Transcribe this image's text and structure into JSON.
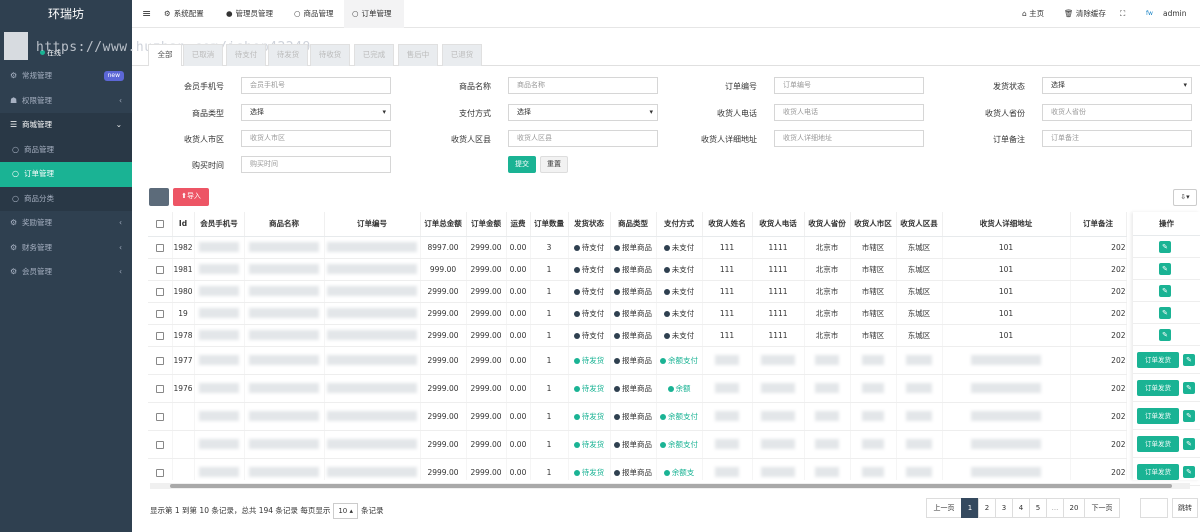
{
  "app": {
    "title": "环瑞坊",
    "status_label": "在线",
    "watermark": "https://www.huzhan.com/ishop42249"
  },
  "sidebar": {
    "items": [
      {
        "label": "常规管理",
        "icon": "cogs-icon",
        "badge": "new"
      },
      {
        "label": "权限管理",
        "icon": "group-icon",
        "arrow": "‹"
      },
      {
        "label": "商城管理",
        "icon": "list-icon",
        "arrow": "⌄"
      },
      {
        "label": "商品管理",
        "icon": "circle-icon"
      },
      {
        "label": "订单管理",
        "icon": "circle-icon"
      },
      {
        "label": "商品分类",
        "icon": "circle-icon"
      },
      {
        "label": "奖励管理",
        "icon": "gear-icon",
        "arrow": "‹"
      },
      {
        "label": "财务管理",
        "icon": "gear-icon",
        "arrow": "‹"
      },
      {
        "label": "会员管理",
        "icon": "gear-icon",
        "arrow": "‹"
      }
    ]
  },
  "topbar": {
    "tabs": [
      {
        "label": "系统配置",
        "icon": "cog-icon"
      },
      {
        "label": "管理员管理",
        "icon": "user-icon"
      },
      {
        "label": "商品管理",
        "icon": "circle-icon"
      },
      {
        "label": "订单管理",
        "icon": "circle-icon"
      }
    ],
    "home": "主页",
    "clear_cache": "清除缓存",
    "user": "admin",
    "avatar_text": "fw"
  },
  "status_tabs": [
    "全部",
    "已取消",
    "待支付",
    "待发货",
    "待收货",
    "已完成",
    "售后中",
    "已退货"
  ],
  "filters": {
    "member_phone": {
      "label": "会员手机号",
      "placeholder": "会员手机号"
    },
    "goods_name": {
      "label": "商品名称",
      "placeholder": "商品名称"
    },
    "order_no": {
      "label": "订单编号",
      "placeholder": "订单编号"
    },
    "ship_status": {
      "label": "发货状态",
      "value": "选择"
    },
    "goods_type": {
      "label": "商品类型",
      "value": "选择"
    },
    "pay_method": {
      "label": "支付方式",
      "value": "选择"
    },
    "receiver_phone": {
      "label": "收货人电话",
      "placeholder": "收货人电话"
    },
    "receiver_province": {
      "label": "收货人省份",
      "placeholder": "收货人省份"
    },
    "receiver_city": {
      "label": "收货人市区",
      "placeholder": "收货人市区"
    },
    "receiver_district": {
      "label": "收货人区县",
      "placeholder": "收货人区县"
    },
    "receiver_address": {
      "label": "收货人详细地址",
      "placeholder": "收货人详细地址"
    },
    "order_remark": {
      "label": "订单备注",
      "placeholder": "订单备注"
    },
    "buy_time": {
      "label": "购买时间",
      "placeholder": "购买时间"
    },
    "submit": "提交",
    "reset": "重置"
  },
  "toolbar": {
    "import": "导入"
  },
  "table": {
    "headers": [
      "Id",
      "会员手机号",
      "商品名称",
      "订单编号",
      "订单总金额",
      "订单金额",
      "运费",
      "订单数量",
      "发货状态",
      "商品类型",
      "支付方式",
      "收货人姓名",
      "收货人电话",
      "收货人省份",
      "收货人市区",
      "收货人区县",
      "收货人详细地址",
      "订单备注"
    ],
    "op_header": "操作",
    "rows": [
      {
        "id": "1982",
        "total": "8997.00",
        "amount": "2999.00",
        "freight": "0.00",
        "qty": "3",
        "ship": "待支付",
        "type": "报单商品",
        "pay": "未支付",
        "name": "111",
        "phone": "1111",
        "prov": "北京市",
        "city": "市辖区",
        "dist": "东城区",
        "addr": "101",
        "remark": "202",
        "action": "edit"
      },
      {
        "id": "1981",
        "total": "999.00",
        "amount": "2999.00",
        "freight": "0.00",
        "qty": "1",
        "ship": "待支付",
        "type": "报单商品",
        "pay": "未支付",
        "name": "111",
        "phone": "1111",
        "prov": "北京市",
        "city": "市辖区",
        "dist": "东城区",
        "addr": "101",
        "remark": "202",
        "action": "edit"
      },
      {
        "id": "1980",
        "total": "2999.00",
        "amount": "2999.00",
        "freight": "0.00",
        "qty": "1",
        "ship": "待支付",
        "type": "报单商品",
        "pay": "未支付",
        "name": "111",
        "phone": "1111",
        "prov": "北京市",
        "city": "市辖区",
        "dist": "东城区",
        "addr": "101",
        "remark": "202",
        "action": "edit"
      },
      {
        "id": "19",
        "total": "2999.00",
        "amount": "2999.00",
        "freight": "0.00",
        "qty": "1",
        "ship": "待支付",
        "type": "报单商品",
        "pay": "未支付",
        "name": "111",
        "phone": "1111",
        "prov": "北京市",
        "city": "市辖区",
        "dist": "东城区",
        "addr": "101",
        "remark": "202",
        "action": "edit"
      },
      {
        "id": "1978",
        "total": "2999.00",
        "amount": "2999.00",
        "freight": "0.00",
        "qty": "1",
        "ship": "待支付",
        "type": "报单商品",
        "pay": "未支付",
        "name": "111",
        "phone": "1111",
        "prov": "北京市",
        "city": "市辖区",
        "dist": "东城区",
        "addr": "101",
        "remark": "202",
        "action": "edit"
      },
      {
        "id": "1977",
        "total": "2999.00",
        "amount": "2999.00",
        "freight": "0.00",
        "qty": "1",
        "ship": "待发货",
        "type": "报单商品",
        "pay": "余额支付",
        "remark": "202",
        "action": "ship"
      },
      {
        "id": "1976",
        "total": "2999.00",
        "amount": "2999.00",
        "freight": "0.00",
        "qty": "1",
        "ship": "待发货",
        "type": "报单商品",
        "pay": "余额",
        "remark": "202",
        "action": "ship"
      },
      {
        "id": "",
        "total": "2999.00",
        "amount": "2999.00",
        "freight": "0.00",
        "qty": "1",
        "ship": "待发货",
        "type": "报单商品",
        "pay": "余额支付",
        "remark": "202",
        "action": "ship"
      },
      {
        "id": "",
        "total": "2999.00",
        "amount": "2999.00",
        "freight": "0.00",
        "qty": "1",
        "ship": "待发货",
        "type": "报单商品",
        "pay": "余额支付",
        "remark": "202",
        "action": "ship"
      },
      {
        "id": "",
        "total": "2999.00",
        "amount": "2999.00",
        "freight": "0.00",
        "qty": "1",
        "ship": "待发货",
        "type": "报单商品",
        "pay": "余额支",
        "remark": "202",
        "action": "ship"
      }
    ],
    "ship_label": "订单发货"
  },
  "footer": {
    "summary_a": "显示第 1 到第 10 条记录，总共 194 条记录 每页显示",
    "page_size": "10",
    "summary_b": "条记录"
  },
  "pagination": {
    "prev": "上一页",
    "pages": [
      "1",
      "2",
      "3",
      "4",
      "5",
      "...",
      "20"
    ],
    "next": "下一页",
    "jump": "跳转"
  }
}
